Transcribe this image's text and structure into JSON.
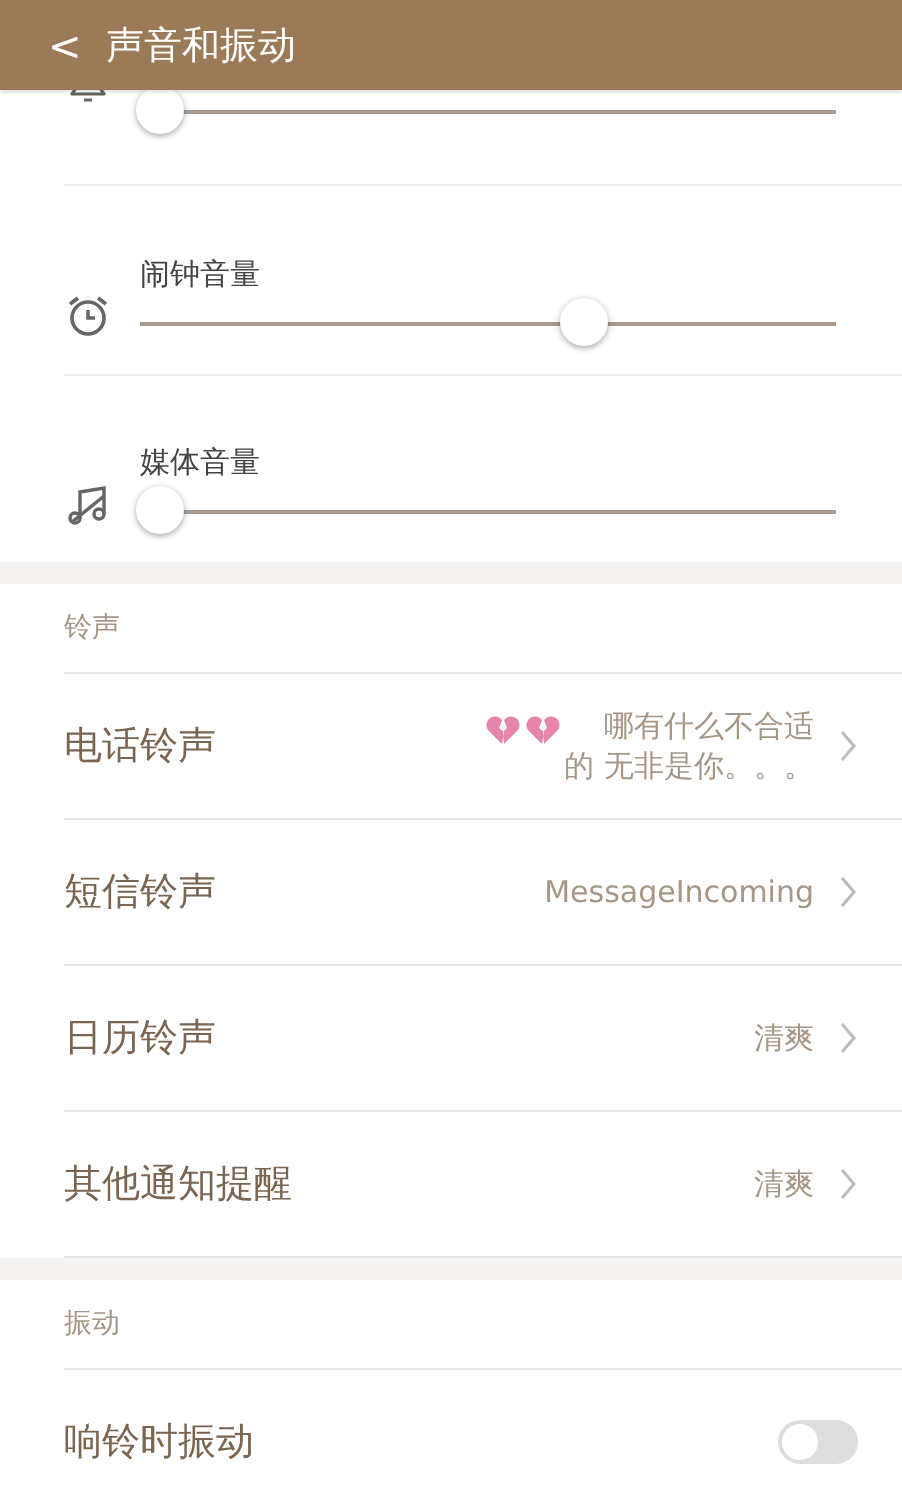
{
  "header": {
    "back": "<",
    "title": "声音和振动"
  },
  "volumes": [
    {
      "kind": "bell",
      "level": 0.0
    },
    {
      "kind": "alarm",
      "label": "闹钟音量",
      "level": 0.65
    },
    {
      "kind": "media",
      "label": "媒体音量",
      "level": 0.0
    }
  ],
  "sections": [
    {
      "title": "铃声",
      "items": [
        {
          "kind": "link",
          "label": "电话铃声",
          "value_lines": [
            "哪有什么不合适",
            "的 无非是你。。。"
          ],
          "hearts": true
        },
        {
          "kind": "link",
          "label": "短信铃声",
          "value": "MessageIncoming"
        },
        {
          "kind": "link",
          "label": "日历铃声",
          "value": "清爽"
        },
        {
          "kind": "link",
          "label": "其他通知提醒",
          "value": "清爽"
        }
      ]
    },
    {
      "title": "振动",
      "items": [
        {
          "kind": "toggle",
          "label": "响铃时振动",
          "on": false
        }
      ]
    }
  ]
}
